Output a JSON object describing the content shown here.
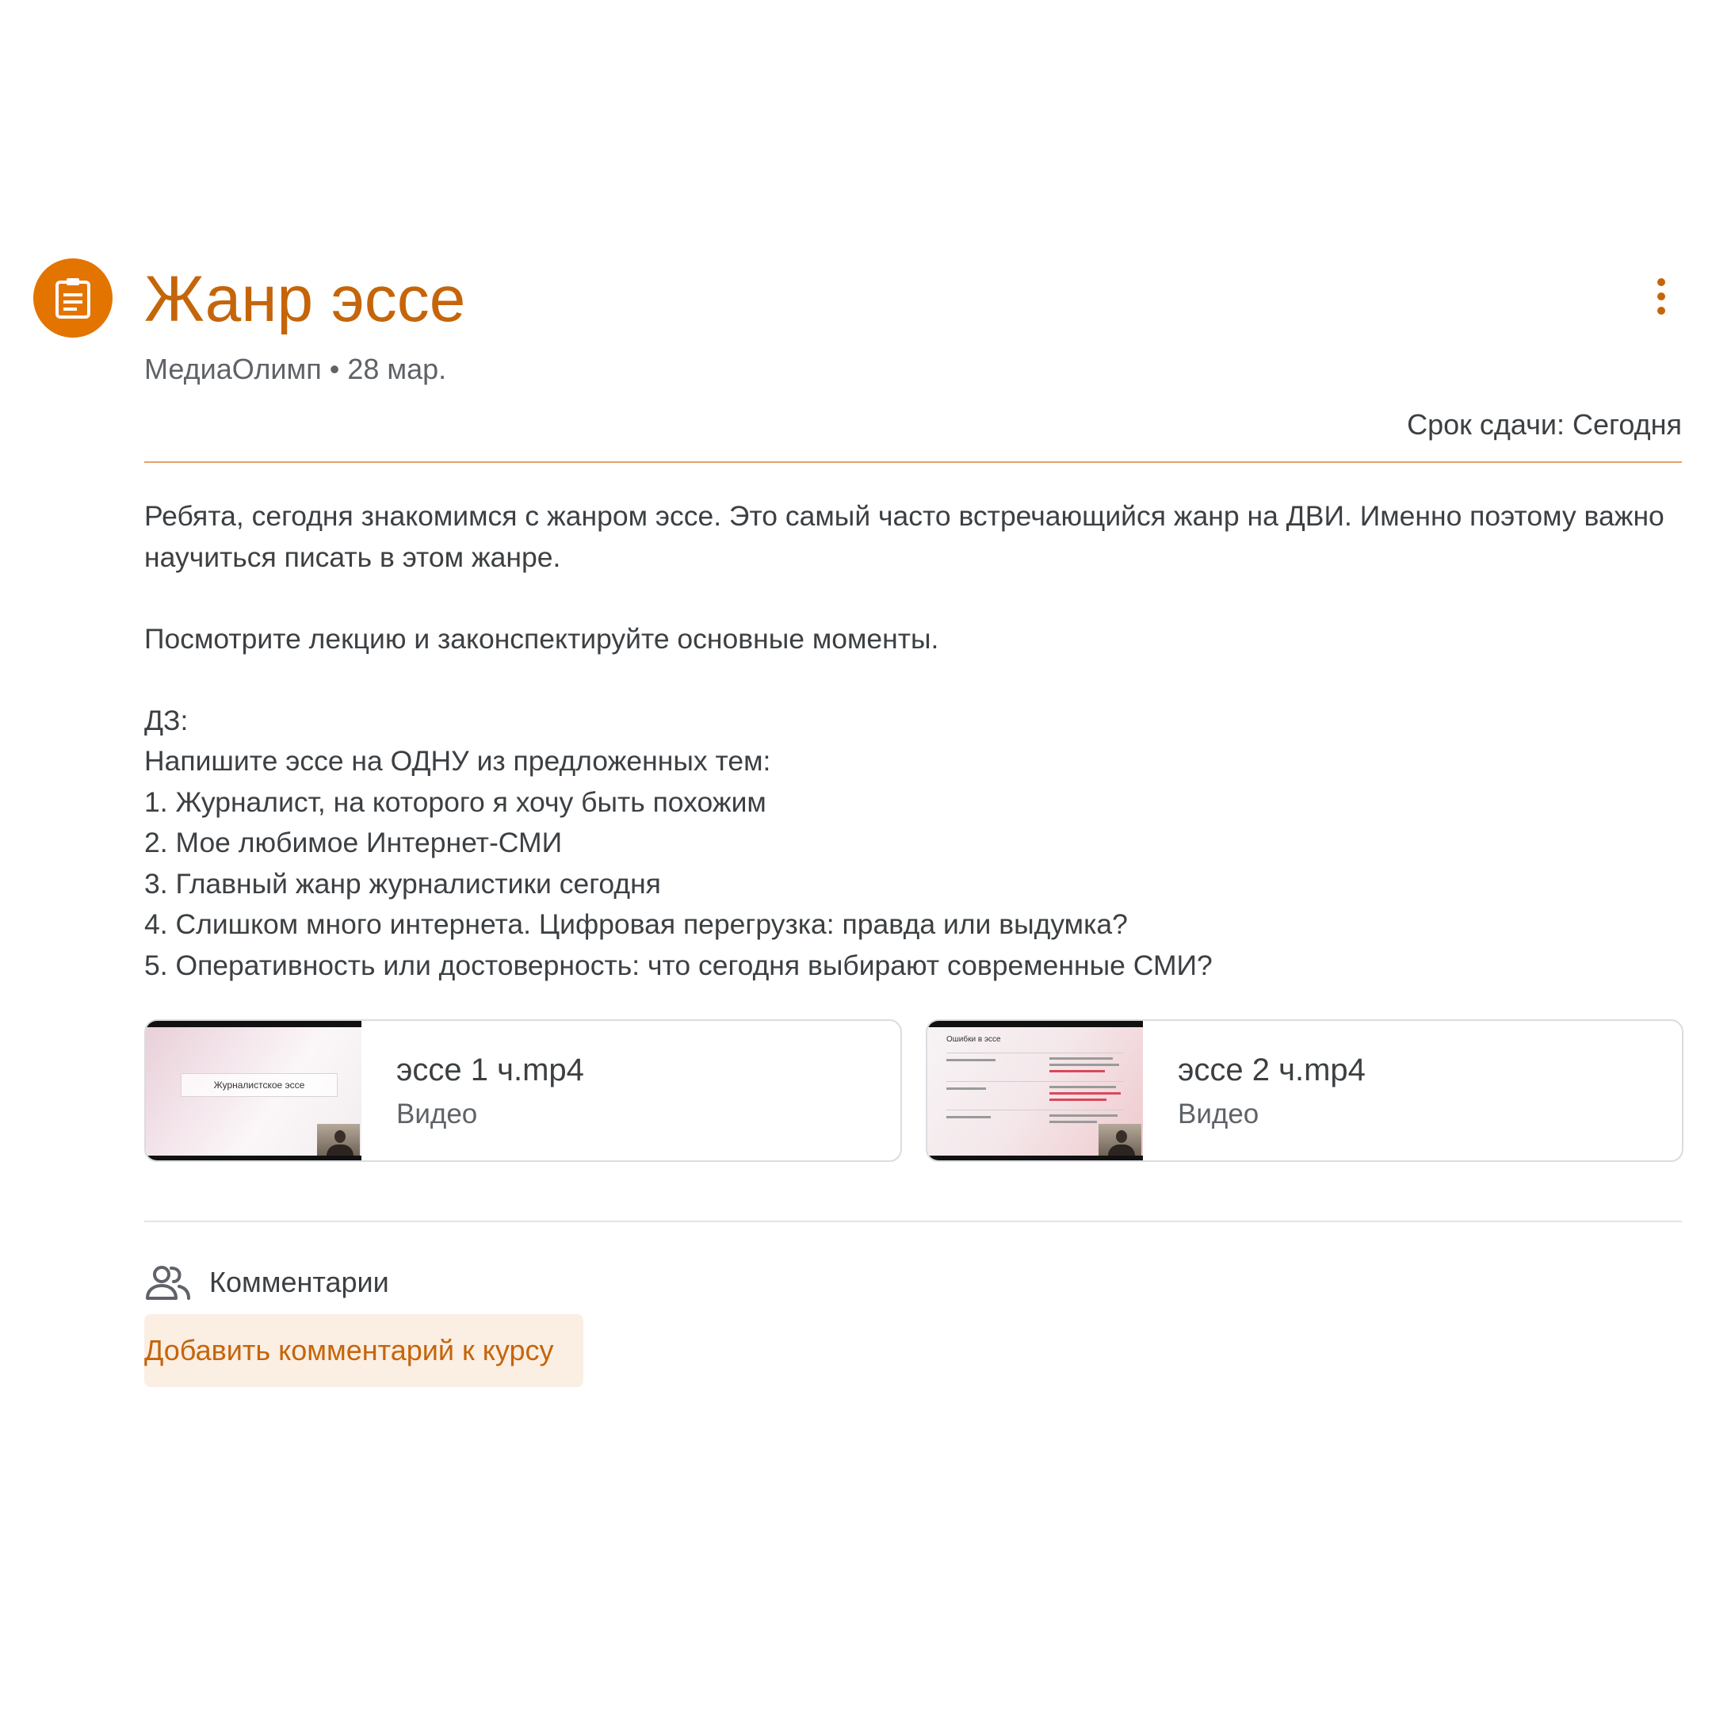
{
  "assignment": {
    "icon": "assignment-icon",
    "accent_color": "#e37400",
    "title": "Жанр эссе",
    "meta": "МедиаОлимп • 28 мар.",
    "due": "Срок сдачи: Сегодня",
    "more_icon": "more-vert-icon"
  },
  "description": {
    "paragraph_1": "Ребята, сегодня знакомимся с жанром эссе. Это самый часто встречающийся жанр на ДВИ. Именно поэтому важно научиться писать в этом жанре.",
    "paragraph_2": "Посмотрите лекцию и законспектируйте основные моменты.",
    "hw_label": "ДЗ:",
    "hw_intro": "Напишите эссе на ОДНУ из предложенных тем:",
    "topics": [
      "1. Журналист, на которого я хочу быть похожим",
      "2. Мое любимое Интернет-СМИ",
      "3. Главный жанр журналистики сегодня",
      "4. Слишком много интернета. Цифровая перегрузка: правда или выдумка?",
      "5. Оперативность или достоверность: что сегодня выбирают современные СМИ?"
    ]
  },
  "attachments": [
    {
      "name": "эссе 1 ч.mp4",
      "type": "Видео",
      "thumb_title": "Журналистское эссе"
    },
    {
      "name": "эссе 2 ч.mp4",
      "type": "Видео",
      "thumb_title": "Ошибки в эссе"
    }
  ],
  "comments": {
    "icon": "people-icon",
    "label": "Комментарии",
    "add_button": "Добавить комментарий к курсу"
  }
}
